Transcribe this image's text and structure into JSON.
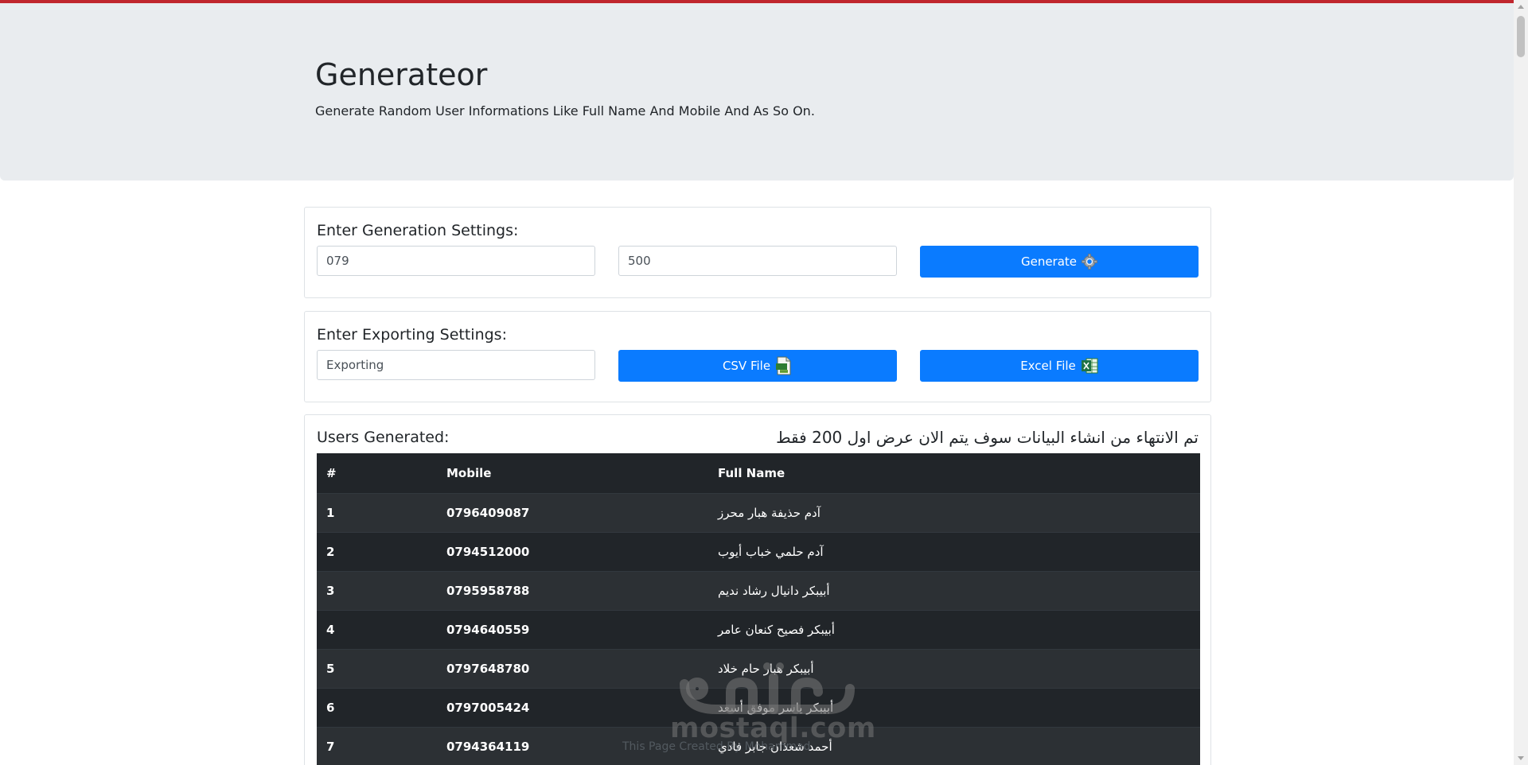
{
  "header": {
    "title": "Generateor",
    "subtitle": "Generate Random User Informations Like Full Name And Mobile And As So On."
  },
  "generation": {
    "heading": "Enter Generation Settings:",
    "prefix_value": "079",
    "count_value": "500",
    "generate_label": "Generate"
  },
  "exporting": {
    "heading": "Enter Exporting Settings:",
    "filename_value": "Exporting",
    "csv_label": "CSV File",
    "excel_label": "Excel File"
  },
  "users": {
    "heading": "Users Generated:",
    "note": "تم الانتهاء من انشاء البيانات سوف يتم الان عرض اول 200 فقط",
    "columns": [
      "#",
      "Mobile",
      "Full Name"
    ],
    "rows": [
      {
        "n": "1",
        "mobile": "0796409087",
        "name": "آدم حذيفة هبار محرز"
      },
      {
        "n": "2",
        "mobile": "0794512000",
        "name": "آدم حلمي خباب أيوب"
      },
      {
        "n": "3",
        "mobile": "0795958788",
        "name": "أبيبكر دانيال رشاد نديم"
      },
      {
        "n": "4",
        "mobile": "0794640559",
        "name": "أبيبكر فصيح كنعان عامر"
      },
      {
        "n": "5",
        "mobile": "0797648780",
        "name": "أبيبكر هبار حام خلاد"
      },
      {
        "n": "6",
        "mobile": "0797005424",
        "name": "أبيبكر ياسر موفق أسعد"
      },
      {
        "n": "7",
        "mobile": "0794364119",
        "name": "أحمد شعذان جابر فادي"
      }
    ]
  },
  "footer": {
    "text": "This Page Created By Mohammad"
  },
  "watermark": {
    "text": "mostaql.com"
  },
  "colors": {
    "accent": "#0a7bff",
    "topbar": "#c0262d",
    "table_bg": "#212529"
  }
}
